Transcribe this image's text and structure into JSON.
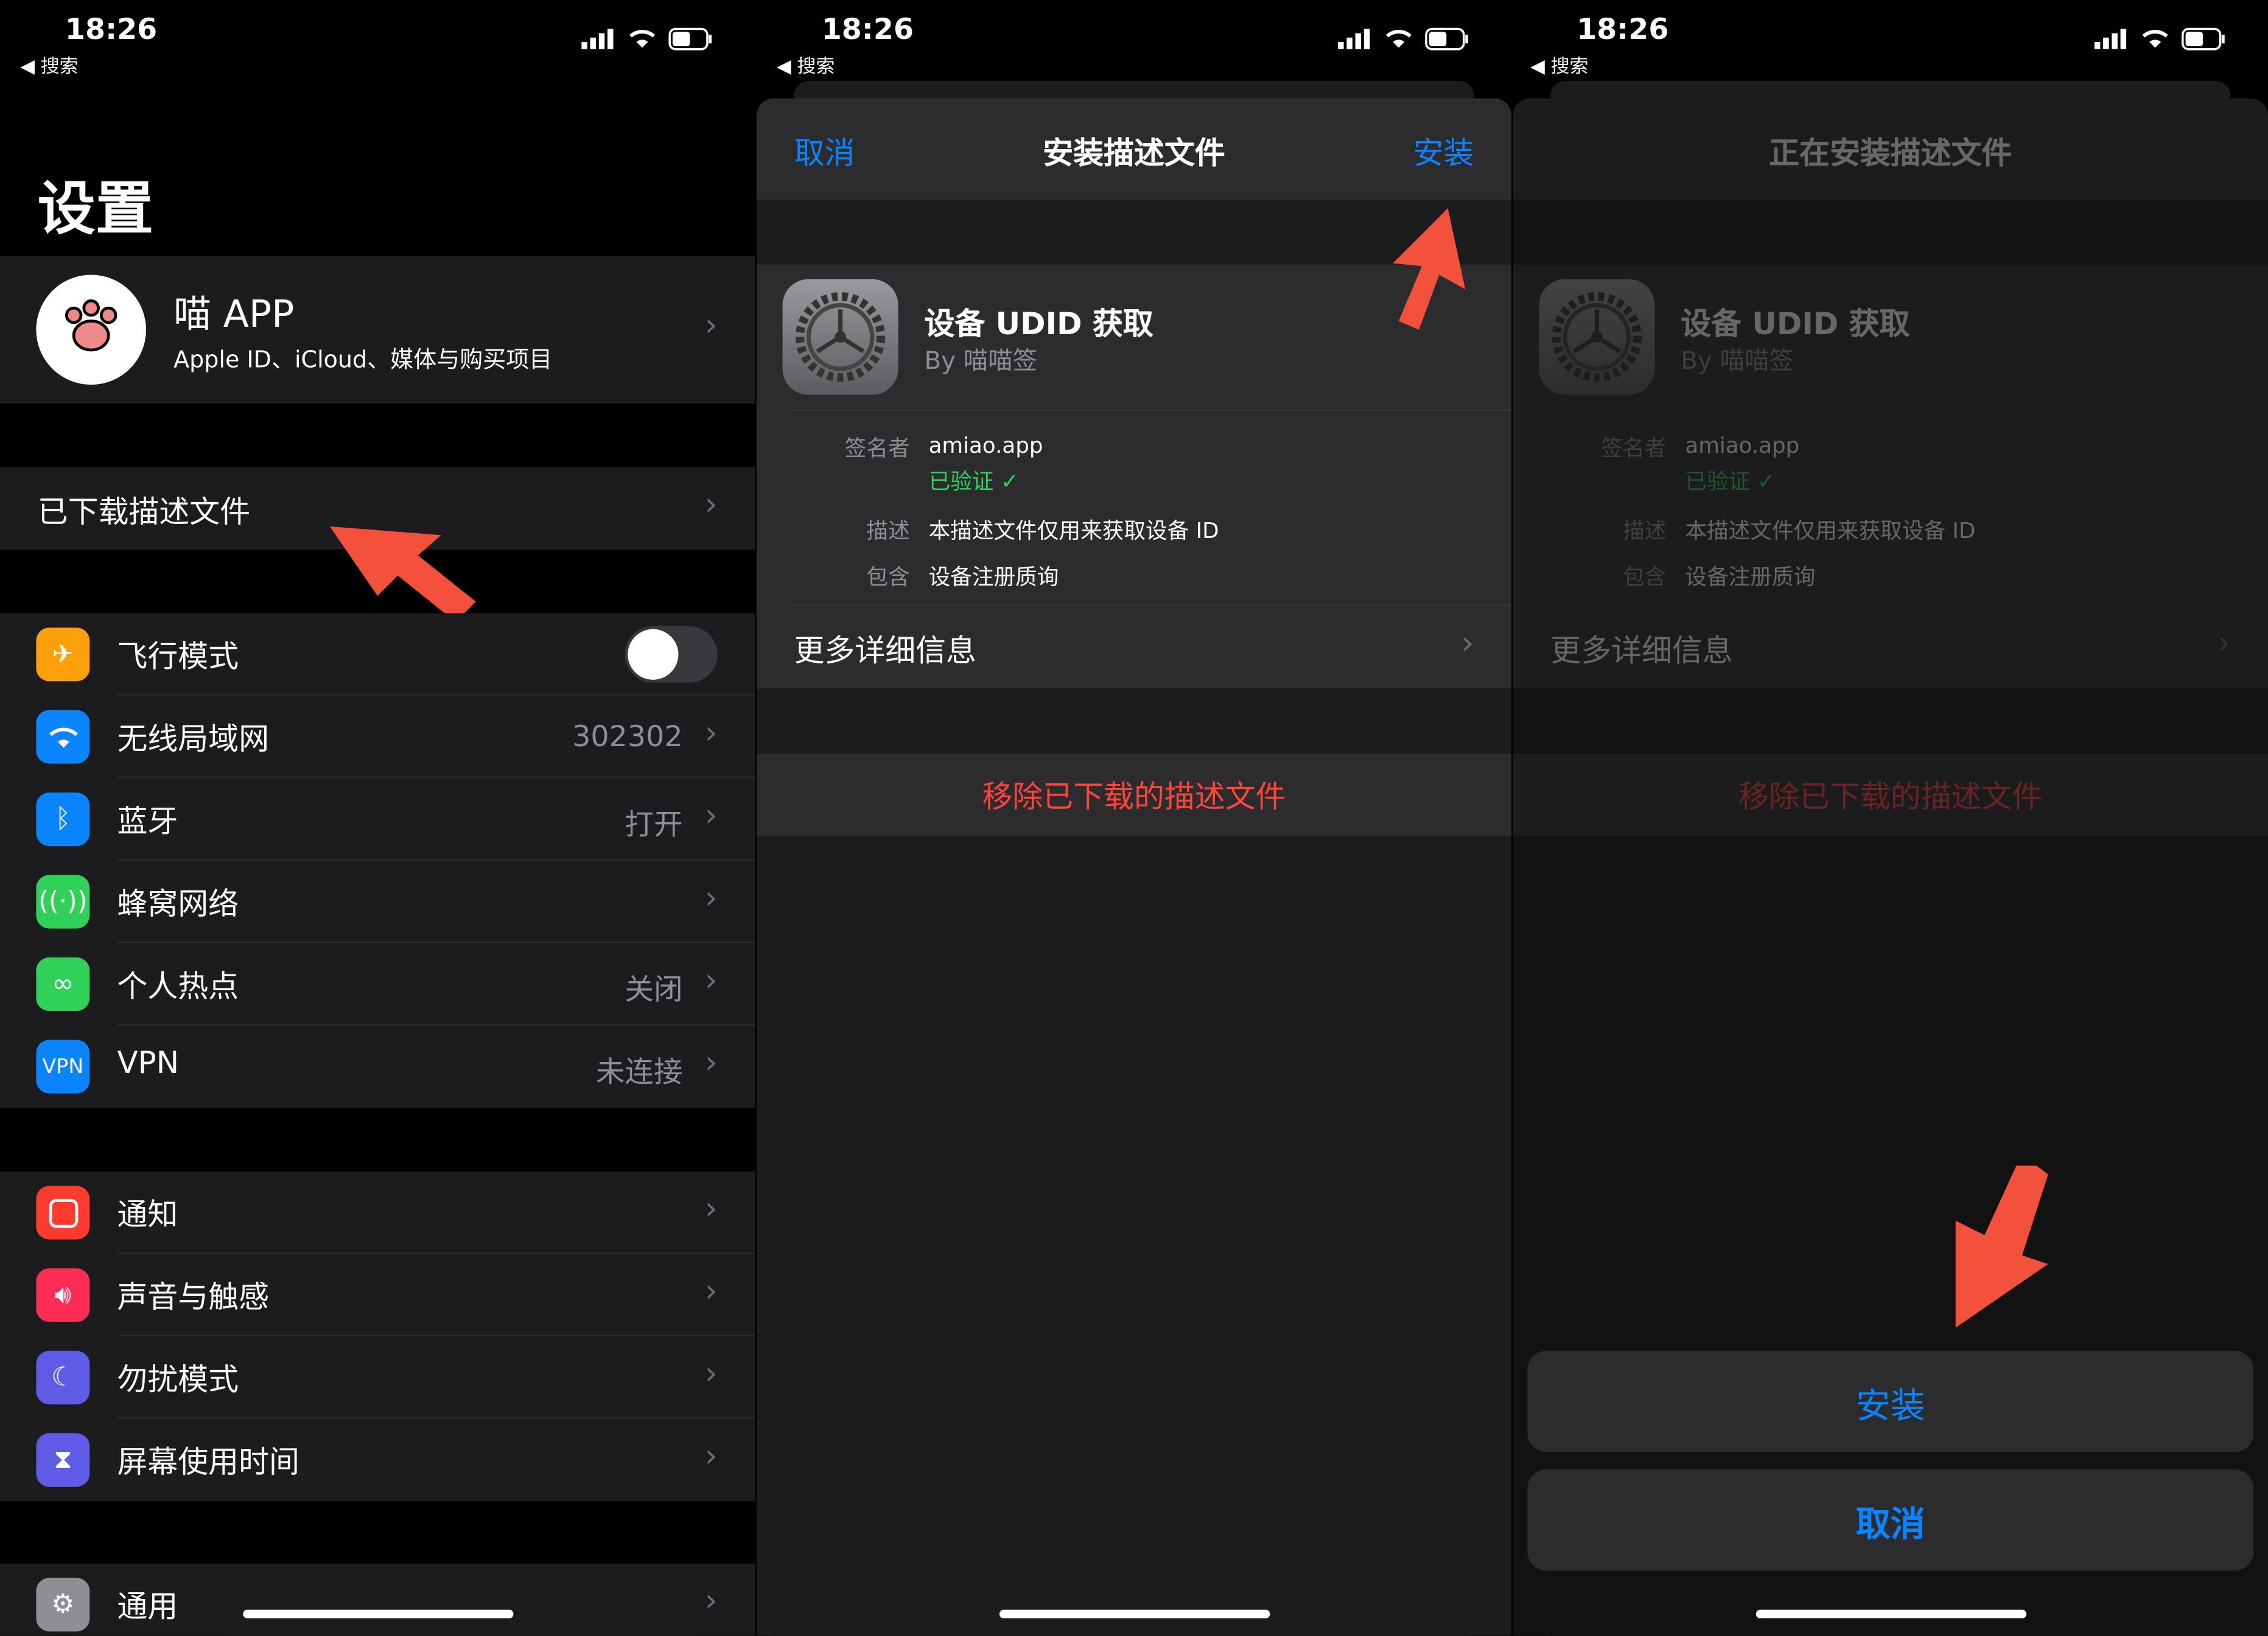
{
  "status": {
    "time": "18:26",
    "back": "◀ 搜索"
  },
  "settings": {
    "title": "设置",
    "profile": {
      "name": "喵 APP",
      "subtitle": "Apple ID、iCloud、媒体与购买项目"
    },
    "downloaded": "已下载描述文件",
    "rows1": [
      {
        "label": "飞行模式",
        "value": ""
      },
      {
        "label": "无线局域网",
        "value": "302302"
      },
      {
        "label": "蓝牙",
        "value": "打开"
      },
      {
        "label": "蜂窝网络",
        "value": ""
      },
      {
        "label": "个人热点",
        "value": "关闭"
      },
      {
        "label": "VPN",
        "value": "未连接",
        "icon_text": "VPN"
      }
    ],
    "rows2": [
      {
        "label": "通知"
      },
      {
        "label": "声音与触感"
      },
      {
        "label": "勿扰模式"
      },
      {
        "label": "屏幕使用时间"
      }
    ],
    "rows3": [
      {
        "label": "通用"
      }
    ]
  },
  "install": {
    "cancel": "取消",
    "title": "安装描述文件",
    "install": "安装",
    "profile_name": "设备 UDID 获取",
    "profile_by": "By 喵喵签",
    "signer_label": "签名者",
    "signer": "amiao.app",
    "verified": "已验证",
    "desc_label": "描述",
    "desc": "本描述文件仅用来获取设备 ID",
    "contains_label": "包含",
    "contains": "设备注册质询",
    "more": "更多详细信息",
    "remove": "移除已下载的描述文件"
  },
  "installing": {
    "title": "正在安装描述文件",
    "install_btn": "安装",
    "cancel_btn": "取消"
  },
  "colors": {
    "accent": "#0a84ff",
    "destructive": "#ff453a",
    "verified": "#30d158",
    "arrow": "#f4513c"
  }
}
